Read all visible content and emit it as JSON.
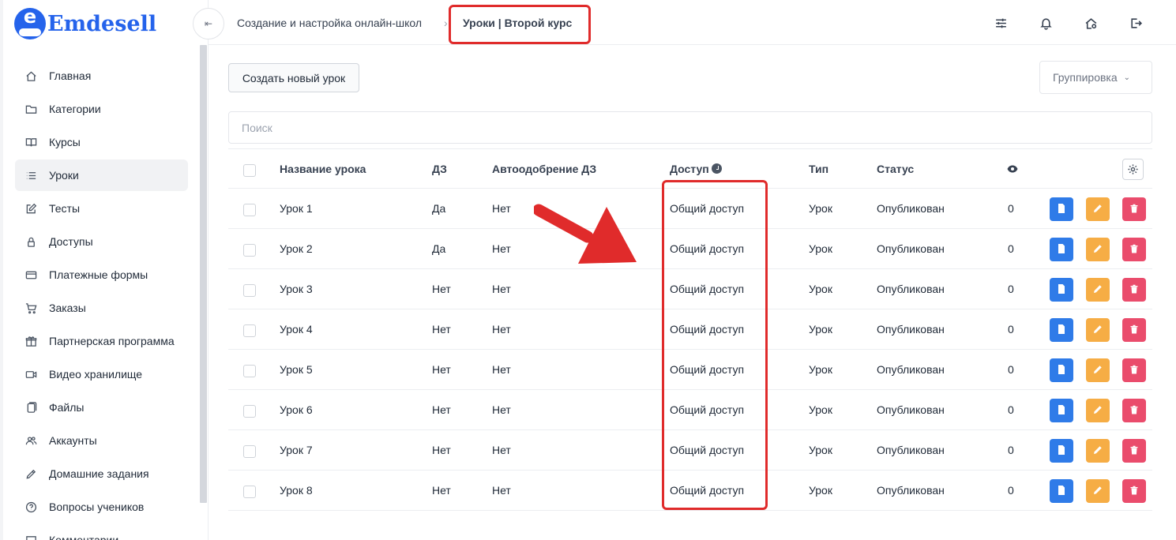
{
  "brand": {
    "name": "Emdesell",
    "logo_letter": "e",
    "accent": "#2563eb"
  },
  "sidebar": {
    "items": [
      {
        "label": "Главная",
        "icon": "home-icon"
      },
      {
        "label": "Категории",
        "icon": "folder-icon"
      },
      {
        "label": "Курсы",
        "icon": "book-icon"
      },
      {
        "label": "Уроки",
        "icon": "list-icon",
        "active": true
      },
      {
        "label": "Тесты",
        "icon": "edit-square-icon"
      },
      {
        "label": "Доступы",
        "icon": "lock-icon"
      },
      {
        "label": "Платежные формы",
        "icon": "credit-card-icon"
      },
      {
        "label": "Заказы",
        "icon": "cart-icon"
      },
      {
        "label": "Партнерская программа",
        "icon": "gift-icon"
      },
      {
        "label": "Видео хранилище",
        "icon": "video-icon"
      },
      {
        "label": "Файлы",
        "icon": "files-icon"
      },
      {
        "label": "Аккаунты",
        "icon": "users-icon"
      },
      {
        "label": "Домашние задания",
        "icon": "pen-icon"
      },
      {
        "label": "Вопросы учеников",
        "icon": "question-icon"
      },
      {
        "label": "Комментарии",
        "icon": "comment-icon"
      }
    ]
  },
  "header": {
    "collapse_glyph": "⇤",
    "breadcrumb_parent": "Создание и настройка онлайн-школ",
    "breadcrumb_separator": "›",
    "breadcrumb_current": "Уроки | Второй курс",
    "icons": [
      "sliders-icon",
      "bell-icon",
      "home-settings-icon",
      "logout-icon"
    ]
  },
  "toolbar": {
    "create_label": "Создать новый урок",
    "grouping_label": "Группировка",
    "grouping_chevron": "⌄",
    "search_placeholder": "Поиск"
  },
  "table": {
    "columns": {
      "name": "Название урока",
      "homework": "ДЗ",
      "auto_approve": "Автоодобрение ДЗ",
      "access": "Доступ",
      "type": "Тип",
      "status": "Статус",
      "views_icon": "eye-icon",
      "settings_icon": "gear-icon"
    },
    "rows": [
      {
        "name": "Урок 1",
        "homework": "Да",
        "auto_approve": "Нет",
        "access": "Общий доступ",
        "type": "Урок",
        "status": "Опубликован",
        "views": "0"
      },
      {
        "name": "Урок 2",
        "homework": "Да",
        "auto_approve": "Нет",
        "access": "Общий доступ",
        "type": "Урок",
        "status": "Опубликован",
        "views": "0"
      },
      {
        "name": "Урок 3",
        "homework": "Нет",
        "auto_approve": "Нет",
        "access": "Общий доступ",
        "type": "Урок",
        "status": "Опубликован",
        "views": "0"
      },
      {
        "name": "Урок 4",
        "homework": "Нет",
        "auto_approve": "Нет",
        "access": "Общий доступ",
        "type": "Урок",
        "status": "Опубликован",
        "views": "0"
      },
      {
        "name": "Урок 5",
        "homework": "Нет",
        "auto_approve": "Нет",
        "access": "Общий доступ",
        "type": "Урок",
        "status": "Опубликован",
        "views": "0"
      },
      {
        "name": "Урок 6",
        "homework": "Нет",
        "auto_approve": "Нет",
        "access": "Общий доступ",
        "type": "Урок",
        "status": "Опубликован",
        "views": "0"
      },
      {
        "name": "Урок 7",
        "homework": "Нет",
        "auto_approve": "Нет",
        "access": "Общий доступ",
        "type": "Урок",
        "status": "Опубликован",
        "views": "0"
      },
      {
        "name": "Урок 8",
        "homework": "Нет",
        "auto_approve": "Нет",
        "access": "Общий доступ",
        "type": "Урок",
        "status": "Опубликован",
        "views": "0"
      }
    ]
  },
  "colors": {
    "doc_button": "#2f7be8",
    "edit_button": "#f6ad45",
    "delete_button": "#ea4c6c",
    "annotation": "#e02b2b"
  }
}
